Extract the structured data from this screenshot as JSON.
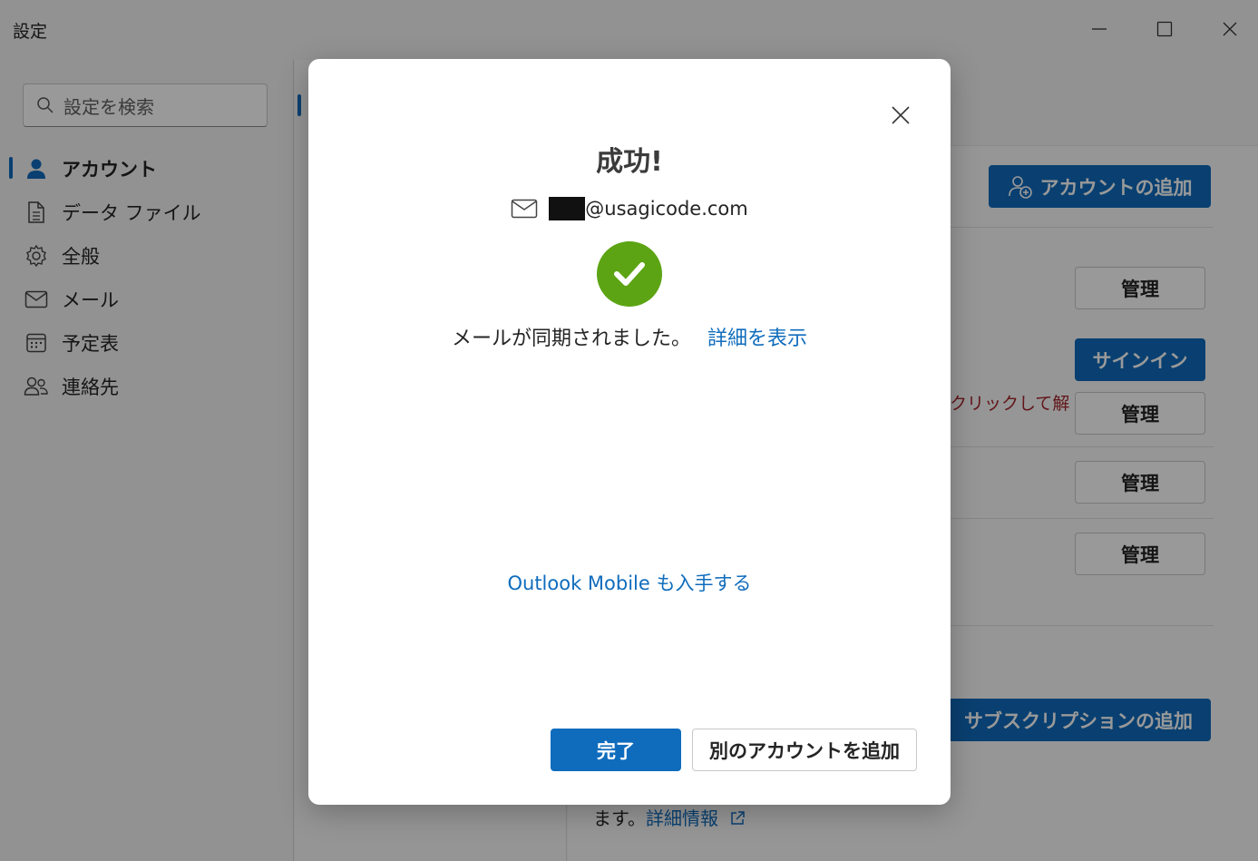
{
  "window": {
    "title": "設定",
    "controls": [
      "minimize-icon",
      "maximize-icon",
      "close-icon"
    ]
  },
  "sidebar": {
    "search_placeholder": "設定を検索",
    "items": [
      {
        "label": "アカウント",
        "icon": "person-icon",
        "active": true
      },
      {
        "label": "データ ファイル",
        "icon": "document-icon",
        "active": false
      },
      {
        "label": "全般",
        "icon": "gear-icon",
        "active": false
      },
      {
        "label": "メール",
        "icon": "mail-icon",
        "active": false
      },
      {
        "label": "予定表",
        "icon": "calendar-icon",
        "active": false
      },
      {
        "label": "連絡先",
        "icon": "people-icon",
        "active": false
      }
    ]
  },
  "content": {
    "add_account_label": "アカウントの追加",
    "manage_label": "管理",
    "signin_label": "サインイン",
    "warning_text": "クリックして解",
    "add_subscription_label": "サブスクリプションの追加",
    "footer_text": "ます。",
    "footer_link": "詳細情報"
  },
  "dialog": {
    "title": "成功!",
    "email_domain": "@usagicode.com",
    "status_text": "メールが同期されました。",
    "details_link": "詳細を表示",
    "mobile_link": "Outlook Mobile も入手する",
    "done_label": "完了",
    "add_another_label": "別のアカウントを追加"
  },
  "colors": {
    "accent": "#0f6cbd",
    "success": "#5ca413",
    "warning": "#a4262c"
  }
}
